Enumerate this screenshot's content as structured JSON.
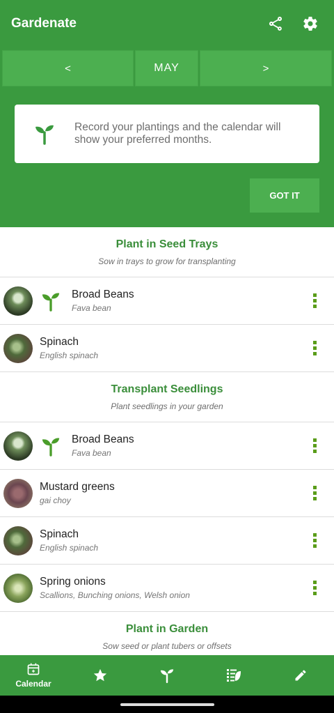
{
  "app": {
    "title": "Gardenate"
  },
  "month_nav": {
    "prev": "<",
    "month": "MAY",
    "next": ">"
  },
  "tip": {
    "text": "Record your plantings and the calendar will show your preferred months.",
    "button": "GOT IT"
  },
  "sections": [
    {
      "title": "Plant in Seed Trays",
      "subtitle": "Sow in trays to grow for transplanting",
      "items": [
        {
          "name": "Broad Beans",
          "sub": "Fava bean",
          "planted": true
        },
        {
          "name": "Spinach",
          "sub": "English spinach",
          "planted": false
        }
      ]
    },
    {
      "title": "Transplant Seedlings",
      "subtitle": "Plant seedlings in your garden",
      "items": [
        {
          "name": "Broad Beans",
          "sub": "Fava bean",
          "planted": true
        },
        {
          "name": "Mustard greens",
          "sub": "gai choy",
          "planted": false
        },
        {
          "name": "Spinach",
          "sub": "English spinach",
          "planted": false
        },
        {
          "name": "Spring onions",
          "sub": "Scallions, Bunching onions, Welsh onion",
          "planted": false
        }
      ]
    },
    {
      "title": "Plant in Garden",
      "subtitle": "Sow seed or plant tubers or offsets"
    }
  ],
  "bottom_nav": {
    "calendar": "Calendar"
  },
  "colors": {
    "primary": "#3a9a3f",
    "button": "#4caf50",
    "accent": "#5a9d1a",
    "heading": "#3a8e3a"
  },
  "icons": [
    "share-icon",
    "settings-icon",
    "sprout-icon",
    "more-vert-icon",
    "calendar-icon",
    "star-icon",
    "seedling-icon",
    "list-icon",
    "pencil-icon"
  ]
}
